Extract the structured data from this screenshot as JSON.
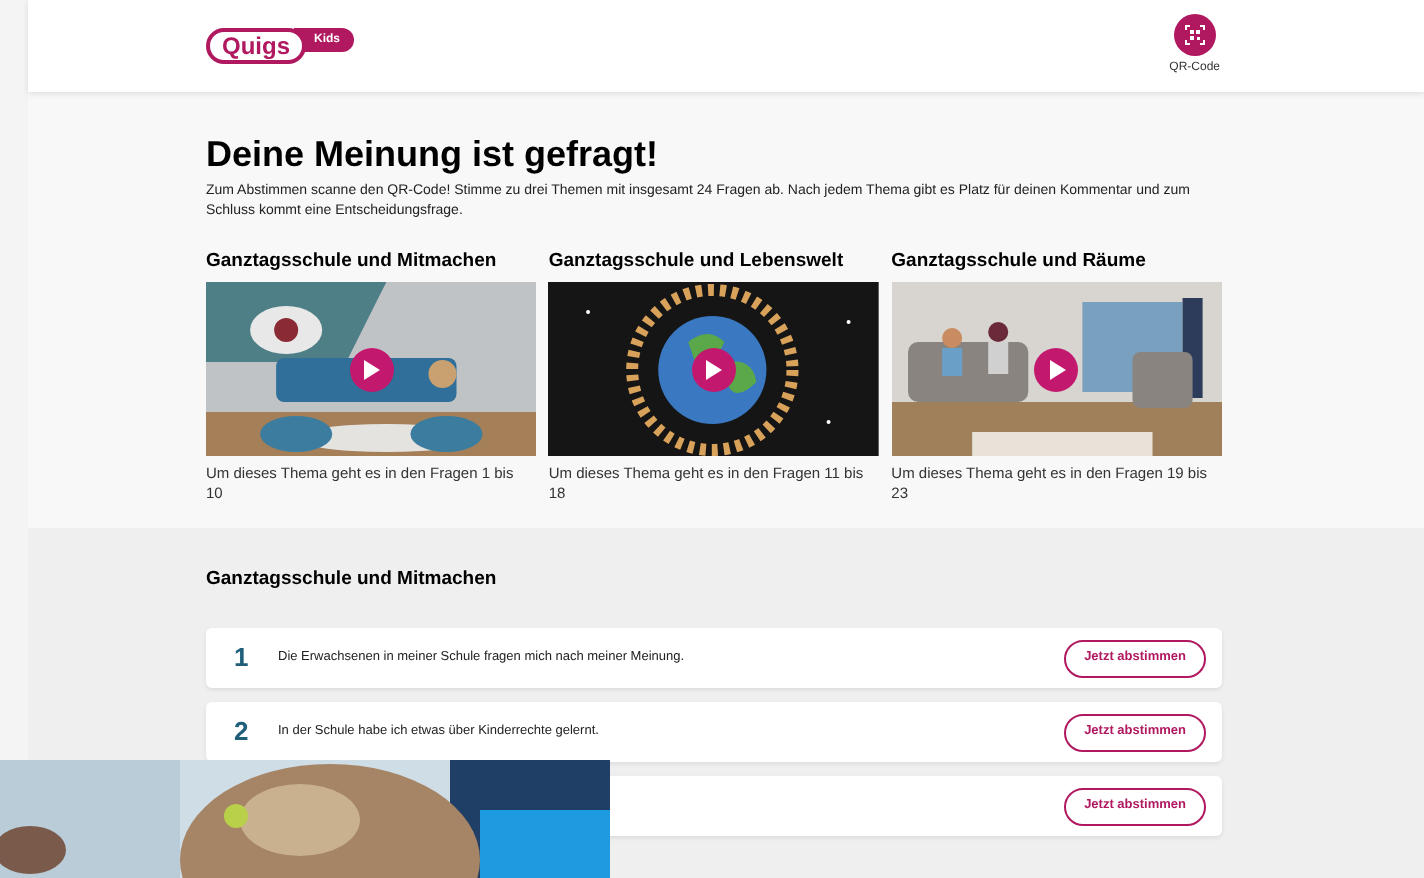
{
  "header": {
    "logo": {
      "text": "Quigs",
      "badge": "Kids"
    },
    "qr_button": {
      "label": "QR-Code"
    }
  },
  "intro": {
    "title": "Deine Meinung ist gefragt!",
    "text": "Zum Abstimmen scanne den QR-Code! Stimme zu drei Themen mit insgesamt 24 Fragen ab. Nach jedem Thema gibt es Platz für deinen Kommentar und zum Schluss kommt eine Entscheidungsfrage."
  },
  "topics": [
    {
      "title": "Ganztagsschule und Mitmachen",
      "caption": "Um dieses Thema geht es in den Fragen 1 bis 10"
    },
    {
      "title": "Ganztagsschule und Lebenswelt",
      "caption": "Um dieses Thema geht es in den Fragen 11 bis 18"
    },
    {
      "title": "Ganztagsschule und Räume",
      "caption": "Um dieses Thema geht es in den Fragen 19 bis 23"
    }
  ],
  "questions_section": {
    "title": "Ganztagsschule und Mitmachen",
    "questions": [
      {
        "number": "1",
        "text": "Die Erwachsenen in meiner Schule fragen mich nach meiner Meinung.",
        "button": "Jetzt abstimmen"
      },
      {
        "number": "2",
        "text": "In der Schule habe ich etwas über Kinderrechte gelernt.",
        "button": "Jetzt abstimmen"
      },
      {
        "button": "Jetzt abstimmen"
      }
    ]
  }
}
